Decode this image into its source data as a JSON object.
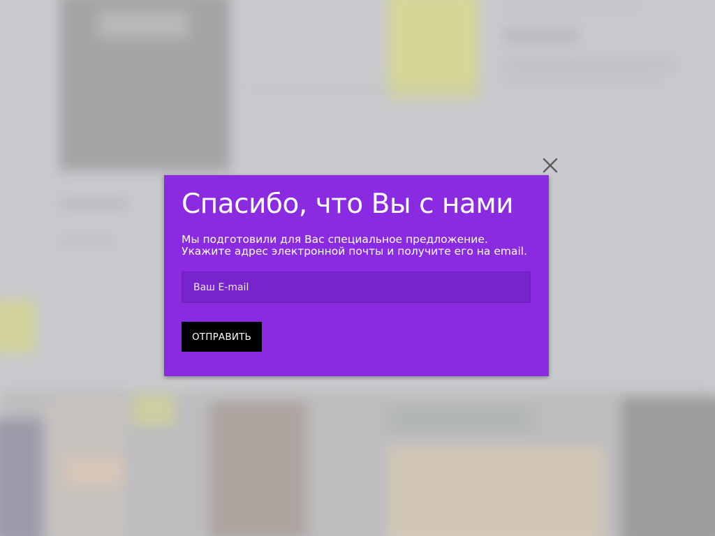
{
  "popup": {
    "title": "Спасибо, что Вы с нами",
    "description": "Мы подготовили для Вас специальное предложение.  Укажите адрес электронной почты и получите его на email.",
    "email_placeholder": "Ваш E-mail",
    "email_value": "",
    "submit_label": "ОТПРАВИТЬ",
    "close_icon": "close-icon"
  },
  "colors": {
    "popup_background": "#8a2be2",
    "input_background": "#7724cd",
    "button_background": "#000000",
    "text": "#ffffff",
    "close_icon": "#5a5a5a"
  }
}
